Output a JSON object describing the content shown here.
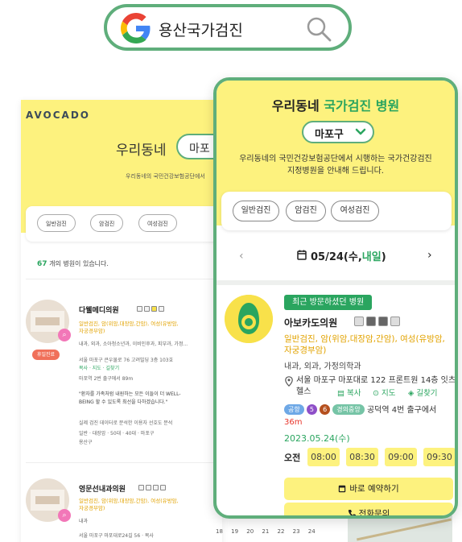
{
  "search": {
    "query": "용산국가검진"
  },
  "background_page": {
    "logo": "AVOCADO",
    "title": "우리동네",
    "region_dropdown": "마포",
    "description": "우리동네의 국민건강보험공단에서",
    "chips": [
      "일반검진",
      "암검진",
      "여성검진"
    ],
    "count_number": "67",
    "count_suffix": "개의 병원이 있습니다.",
    "cards": [
      {
        "name": "다웰메디의원",
        "holiday_badge": "휴일진료",
        "categories_line1": "일반검진, 암(위암,대장암,간암), 여성(유방암,",
        "categories_line2": "자궁경부암)",
        "subjects": "내과, 외과, 소아청소년과, 이비인후과, 피부과, 가정...",
        "address": "서울 마포구 큰우물로 76 고려빌딩 3층 103호",
        "actions": "복사 · 지도 · 길찾기",
        "subway": "마포역 2번 출구에서 89m",
        "quote_line1": "\"환자를 가족처럼 내원하는 모든 이들이 더 WELL-",
        "quote_line2": "BEING 할 수 있도록 최선을 다하겠습니다.\"",
        "stats_line1": "실제 검진 데이터로 분석한 이용자 선호도 분석",
        "stats_line2": "일반 · 대장암 · 50대 · 40대 · 마포구",
        "stats_line3": "용산구"
      },
      {
        "name": "영문선내과의원",
        "categories_line1": "일반검진, 암(위암,대장암,간암), 여성(유방암,",
        "categories_line2": "자궁경부암)",
        "subjects": "내과",
        "address": "서울 마포구 마포대로24길 56 · 복사"
      }
    ],
    "calendar_days": "18 19 20 21 22 23 24"
  },
  "panel": {
    "title_part1": "우리동네",
    "title_part2": "국가검진 병원",
    "region_dropdown": "마포구",
    "description_line1": "우리동네의 국민건강보험공단에서 시행하는 국가건강검진",
    "description_line2": "지정병원을 안내해 드립니다.",
    "chips": [
      "일반검진",
      "암검진",
      "여성검진"
    ],
    "date": "05/24(수,",
    "date_highlight": "내일",
    "date_close": ")",
    "hospital": {
      "badge": "최근 방문하셨던 병원",
      "name": "아보카도의원",
      "categories": "일반검진, 암(위암,대장암,간암), 여성(유방암, 자궁경부암)",
      "subjects": "내과, 외과, 가정의학과",
      "address": "서울 마포구 마포대로 122 프론트원 14층 잇츠헬스",
      "actions": {
        "copy": "복사",
        "map": "지도",
        "route": "길찾기"
      },
      "subway": {
        "airport_line": "공항",
        "line5": "5",
        "line6": "6",
        "gyeongui_line": "경의중앙",
        "text": "공덕역 4번 출구에서",
        "distance": "36m"
      },
      "visit_date": "2023.05.24(수)",
      "period": "오전",
      "time_slots": [
        "08:00",
        "08:30",
        "09:00",
        "09:30"
      ],
      "reserve_button": "바로 예약하기",
      "call_button": "전화문의"
    }
  },
  "colors": {
    "brand_green": "#2aa55f",
    "brand_yellow": "#fdf27e",
    "category_orange": "#e2a300",
    "distance_red": "#e8352b"
  }
}
